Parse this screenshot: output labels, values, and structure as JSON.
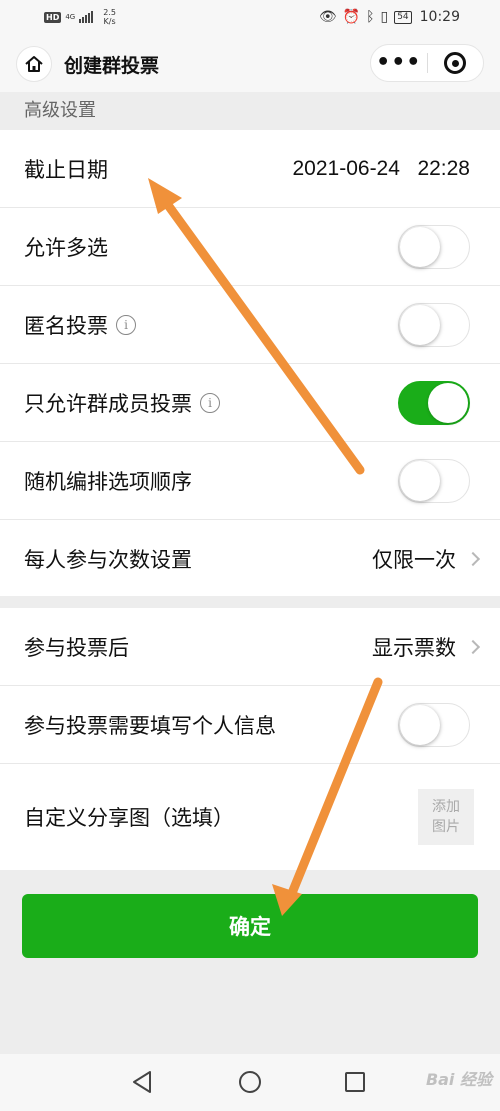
{
  "status_bar": {
    "hd": "HD",
    "network": "4G",
    "speed_value": "2.5",
    "speed_unit": "K/s",
    "battery": "54",
    "time": "10:29"
  },
  "navbar": {
    "title": "创建群投票",
    "more": "•••"
  },
  "section_title": "高级设置",
  "settings": {
    "deadline": {
      "label": "截止日期",
      "date": "2021-06-24",
      "time": "22:28"
    },
    "multi_select": {
      "label": "允许多选",
      "on": false
    },
    "anonymous": {
      "label": "匿名投票",
      "info": "i",
      "on": false
    },
    "members_only": {
      "label": "只允许群成员投票",
      "info": "i",
      "on": true
    },
    "random_order": {
      "label": "随机编排选项顺序",
      "on": false
    },
    "vote_count": {
      "label": "每人参与次数设置",
      "value": "仅限一次"
    }
  },
  "after_vote": {
    "label": "参与投票后",
    "value": "显示票数",
    "personal_info": {
      "label": "参与投票需要填写个人信息",
      "on": false
    },
    "share_image": {
      "label": "自定义分享图（选填）",
      "add_line1": "添加",
      "add_line2": "图片"
    }
  },
  "confirm_button": "确定",
  "watermark": "Bai 经验",
  "colors": {
    "accent": "#1aad19",
    "arrow": "#f0913a"
  }
}
